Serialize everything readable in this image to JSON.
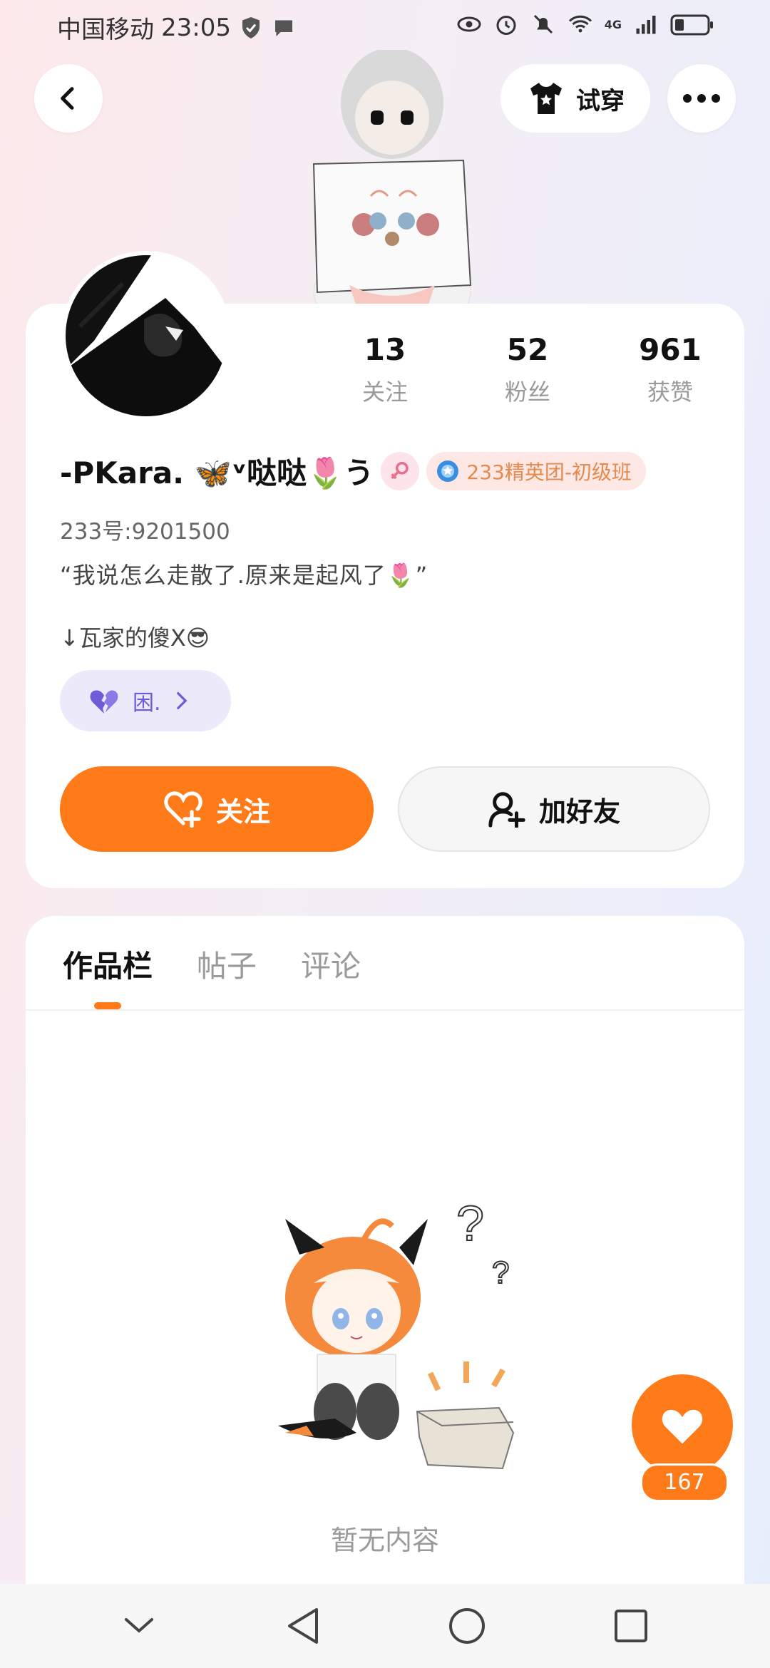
{
  "status_bar": {
    "carrier": "中国移动",
    "time": "23:05",
    "network": "4G"
  },
  "header": {
    "tryon_label": "试穿",
    "icons": [
      "back-icon",
      "shirt-icon",
      "more-icon"
    ]
  },
  "profile": {
    "stats": [
      {
        "value": "13",
        "label": "关注"
      },
      {
        "value": "52",
        "label": "粉丝"
      },
      {
        "value": "961",
        "label": "获赞"
      }
    ],
    "name": "-PKara. 🦋ᵛ哒哒🌷う",
    "badge_label": "233精英团-初级班",
    "uid": "233号:9201500",
    "bio_line1": "“我说怎么走散了.原来是起风了🌷”",
    "bio_line2": "↓瓦家的傻X😎",
    "mood_label": "困.",
    "follow_label": "关注",
    "add_friend_label": "加好友"
  },
  "tabs": [
    {
      "label": "作品栏",
      "active": true
    },
    {
      "label": "帖子",
      "active": false
    },
    {
      "label": "评论",
      "active": false
    }
  ],
  "empty_state": {
    "text": "暂无内容"
  },
  "like_fab": {
    "count": "167"
  },
  "colors": {
    "accent": "#ff7a18",
    "mood": "#6f5bd8"
  }
}
